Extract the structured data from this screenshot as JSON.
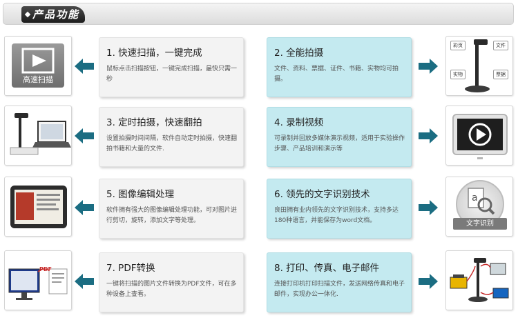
{
  "header": {
    "title": "产品功能"
  },
  "colors": {
    "accent": "#1b6d82",
    "card_gray": "#f3f3f3",
    "card_blue": "#c4eaf0"
  },
  "features": [
    {
      "title": "1. 快速扫描，一键完成",
      "desc": "鼠标点击扫描按钮，一键完成扫描，最快只需一秒"
    },
    {
      "title": "2. 全能拍摄",
      "desc": "文件、资料、票据、证件、书籍、实物均可拍摄。"
    },
    {
      "title": "3. 定时拍摄，快速翻拍",
      "desc": "设置拍摄时间间隔，软件自动定时拍摄，快速翻拍书籍和大量的文件."
    },
    {
      "title": "4. 录制视频",
      "desc": "可录制并回放多媒体演示视频，适用于实验操作步骤、产品培训和演示等"
    },
    {
      "title": "5. 图像编辑处理",
      "desc": "软件拥有强大的图像编辑处理功能，可对图片进行剪切，旋转，添加文字等处理。"
    },
    {
      "title": "6. 领先的文字识别技术",
      "desc": "良田拥有业内领先的文字识别技术，支持多达180种语言，并能保存为word文档。"
    },
    {
      "title": "7. PDF转换",
      "desc": "一键将扫描的图片文件转换为PDF文件，可在多种设备上查看。"
    },
    {
      "title": "8. 打印、传真、电子邮件",
      "desc": "连接打印机打印扫描文件，发送网络传真和电子邮件，实现办公一体化."
    }
  ],
  "thumbs": {
    "scan_label": "高速扫描",
    "doc_badges": [
      "彩页",
      "文件",
      "实物",
      "票据"
    ],
    "ocr_label": "文字识别",
    "pdf_tag": "PDF"
  }
}
